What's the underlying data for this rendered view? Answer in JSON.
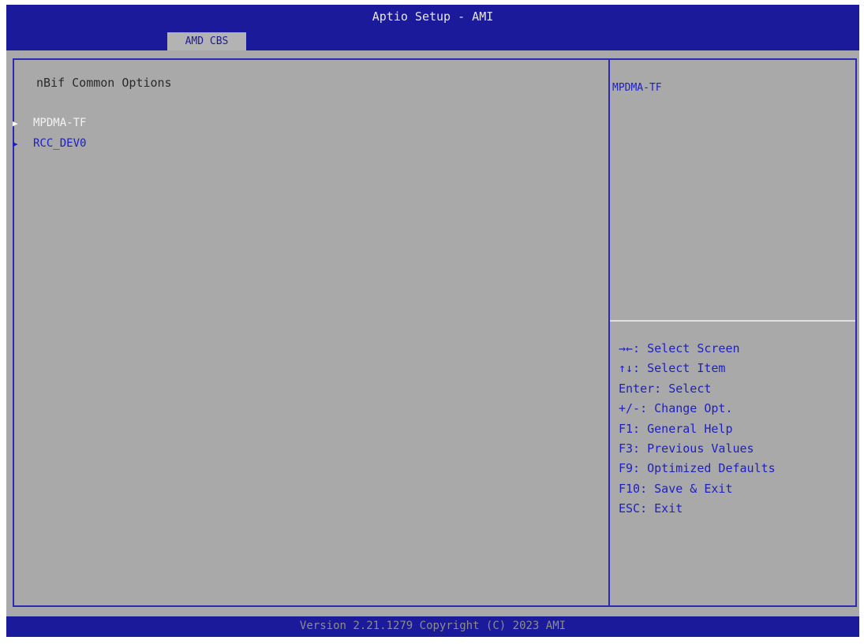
{
  "header": {
    "title": "Aptio Setup - AMI",
    "tabs": [
      {
        "label": "AMD CBS"
      }
    ]
  },
  "main": {
    "section_title": "nBif Common Options",
    "items": [
      {
        "label": "MPDMA-TF",
        "selected": true
      },
      {
        "label": "RCC_DEV0",
        "selected": false
      }
    ],
    "arrow_icon": "right-triangle-icon"
  },
  "help": {
    "description": "MPDMA-TF",
    "keys": [
      "→←: Select Screen",
      "↑↓: Select Item",
      "Enter: Select",
      "+/-: Change Opt.",
      "F1: General Help",
      "F3: Previous Values",
      "F9: Optimized Defaults",
      "F10: Save & Exit",
      "ESC: Exit"
    ]
  },
  "footer": {
    "version": "Version 2.21.1279 Copyright (C) 2023 AMI"
  },
  "colors": {
    "header_blue": "#1b1a9a",
    "panel_gray": "#a9a9a9",
    "link_blue": "#1d1fbf",
    "selected_white": "#f2f2f2"
  }
}
